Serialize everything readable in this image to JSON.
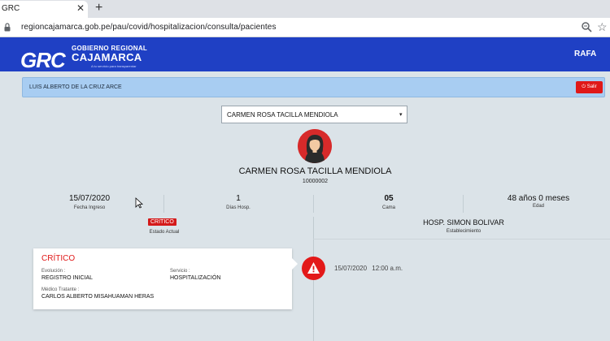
{
  "browser": {
    "tab_title": "GRC",
    "tab_close": "✕",
    "new_tab": "+",
    "url": "regioncajamarca.gob.pe/pau/covid/hospitalizacion/consulta/pacientes"
  },
  "header": {
    "logo_text": "GRC",
    "org_line1": "GOBIERNO REGIONAL",
    "org_line2": "CAJAMARCA",
    "org_tagline": "A tu servicio para transparentar",
    "user": "RAFA"
  },
  "infobar": {
    "user_fullname": "LUIS ALBERTO DE LA CRUZ ARCE",
    "logout_label": "⏻ Salir"
  },
  "patient_select": {
    "selected": "CARMEN ROSA TACILLA MENDIOLA",
    "caret": "▾"
  },
  "patient": {
    "name": "CARMEN ROSA TACILLA MENDIOLA",
    "id": "10000002"
  },
  "stats": [
    {
      "value": "15/07/2020",
      "label": "Fecha Ingreso"
    },
    {
      "value": "1",
      "label": "Días Hosp."
    },
    {
      "value": "05",
      "label": "Cama"
    },
    {
      "value": "48 años 0 meses",
      "label": "Edad"
    }
  ],
  "status": {
    "badge": "CRITICO",
    "label": "Estado Actual",
    "establishment": "HOSP. SIMON BOLIVAR",
    "establishment_label": "Establecimiento"
  },
  "card": {
    "title": "CRÍTICO",
    "evolution_label": "Evolución :",
    "evolution_value": "REGISTRO INICIAL",
    "service_label": "Servicio :",
    "service_value": "HOSPITALIZACIÓN",
    "doctor_label": "Médico Tratante :",
    "doctor_value": "CARLOS ALBERTO MISAHUAMAN HERAS"
  },
  "event": {
    "date": "15/07/2020",
    "time": "12:00 a.m."
  },
  "colors": {
    "header_blue": "#1f40c4",
    "critical_red": "#e01818",
    "info_blue": "#a8cdf2"
  }
}
